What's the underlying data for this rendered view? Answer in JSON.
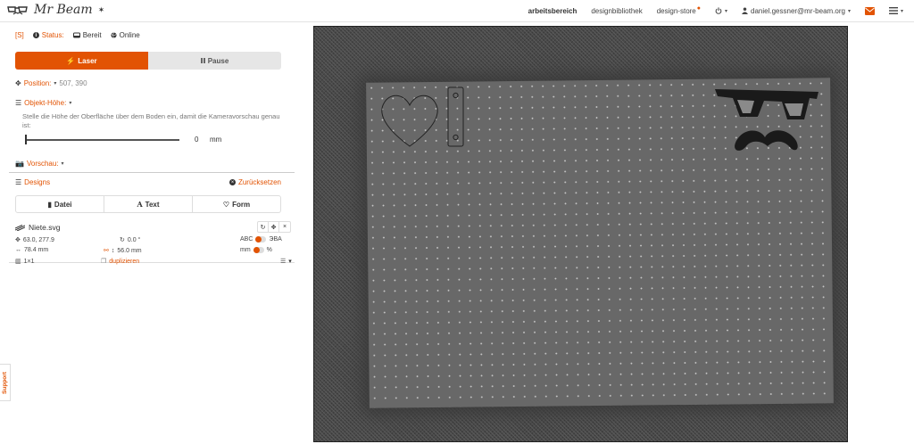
{
  "header": {
    "logo_text": "Mr Beam",
    "nav": [
      {
        "label": "arbeitsbereich",
        "active": true
      },
      {
        "label": "designbibliothek"
      },
      {
        "label": "design-store"
      },
      {
        "label": ""
      },
      {
        "label": "daniel.gessner@mr-beam.org"
      }
    ]
  },
  "status": {
    "shortcut": "[S]",
    "status_label": "Status:",
    "state": "Bereit",
    "connection": "Online"
  },
  "tabs": {
    "laser": "Laser",
    "pause": "Pause"
  },
  "position": {
    "label": "Position:",
    "value": "507, 390"
  },
  "object_height": {
    "label": "Objekt-Höhe:",
    "description": "Stelle die Höhe der Oberfläche über dem Boden ein, damit die Kameravorschau genau ist:",
    "value": "0",
    "unit": "mm",
    "slider_fraction": 0
  },
  "preview": {
    "label": "Vorschau:"
  },
  "designs": {
    "label": "Designs",
    "reset": "Zurücksetzen",
    "buttons": [
      "Datei",
      "Text",
      "Form"
    ]
  },
  "design_item": {
    "filename": "Niete.svg",
    "position": "63.0, 277.9",
    "rotation": "0.0 °",
    "width": "78.4 mm",
    "height": "56.0 mm",
    "grid": "1×1",
    "duplicate": "duplizieren",
    "toggle1_left": "ABC",
    "toggle1_right": "ЭBA",
    "toggle2_left": "mm",
    "toggle2_right": "%"
  },
  "support": {
    "label": "Support"
  },
  "colors": {
    "accent": "#e25303"
  }
}
